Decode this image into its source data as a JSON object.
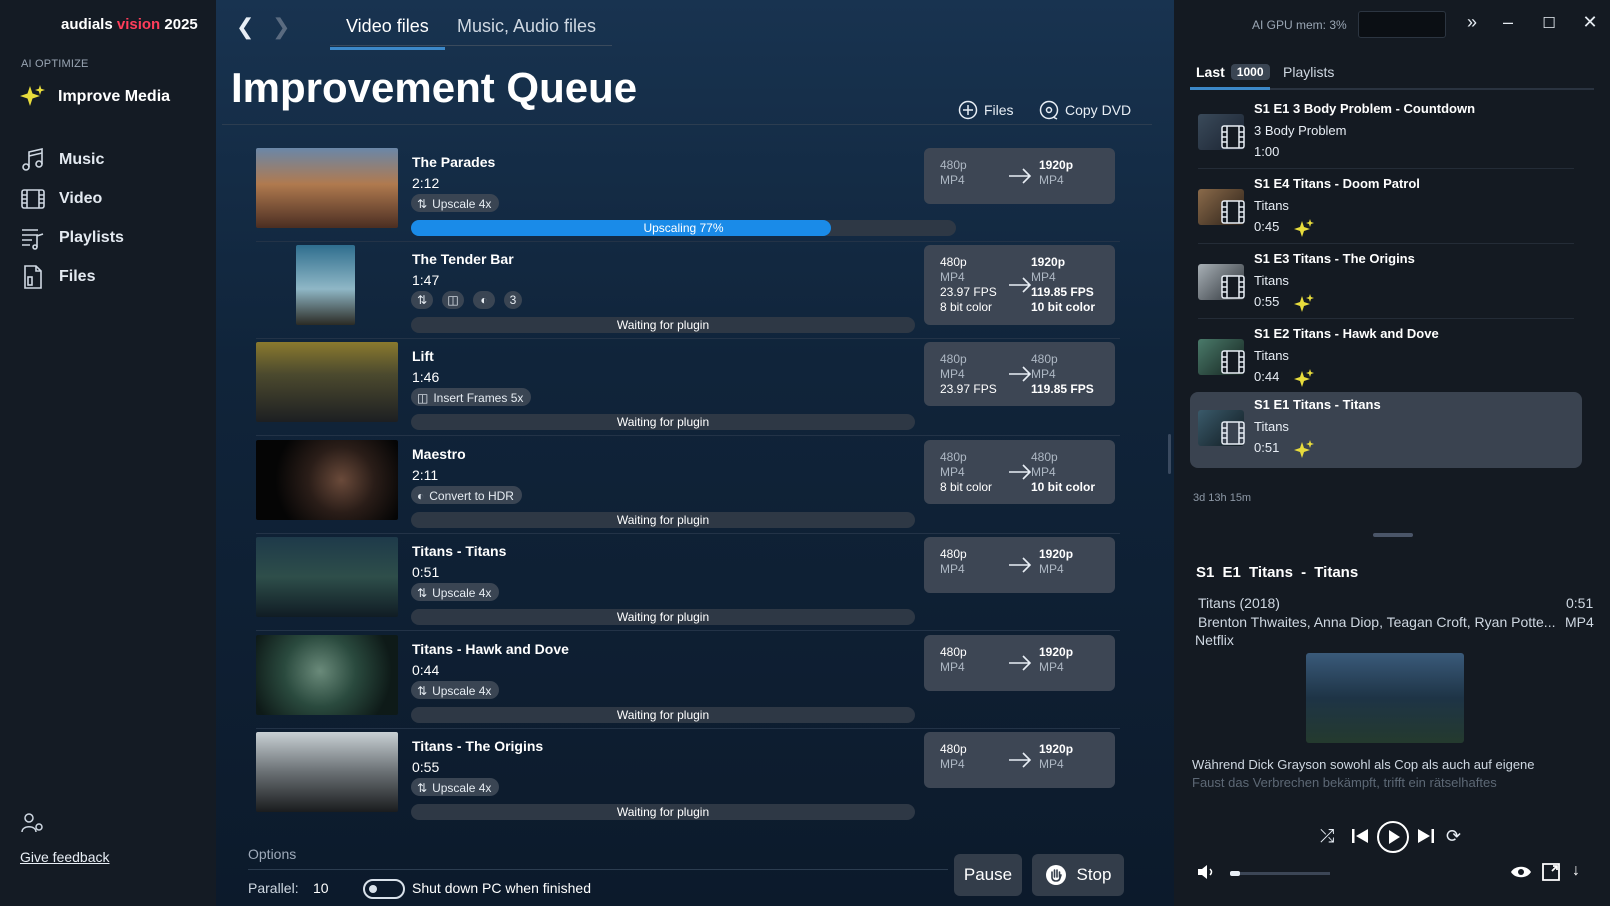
{
  "app": {
    "brand_name": "audials",
    "brand_product": "vision",
    "brand_year": "2025"
  },
  "sidebar": {
    "section": "AI OPTIMIZE",
    "improve": "Improve Media",
    "items": [
      {
        "label": "Music",
        "icon": "music-note-icon"
      },
      {
        "label": "Video",
        "icon": "film-icon"
      },
      {
        "label": "Playlists",
        "icon": "playlist-icon"
      },
      {
        "label": "Files",
        "icon": "file-icon"
      }
    ],
    "feedback": "Give feedback"
  },
  "main": {
    "tabs": [
      "Video files",
      "Music, Audio files"
    ],
    "title": "Improvement Queue",
    "files_btn": "Files",
    "copy_dvd_btn": "Copy DVD",
    "queue": [
      {
        "name": "The Parades",
        "duration": "2:12",
        "chip": "Upscale 4x",
        "status": "Upscaling 77%",
        "progress": 0.77,
        "from": [
          "480p",
          "MP4"
        ],
        "to": [
          "1920p",
          "MP4"
        ]
      },
      {
        "name": "The Tender Bar",
        "duration": "1:47",
        "chip_count": "3",
        "status": "Waiting for plugin",
        "from": [
          "480p",
          "MP4",
          "23.97 FPS",
          "8 bit color"
        ],
        "to": [
          "1920p",
          "MP4",
          "119.85 FPS",
          "10 bit color"
        ]
      },
      {
        "name": "Lift",
        "duration": "1:46",
        "chip": "Insert Frames 5x",
        "status": "Waiting for plugin",
        "from": [
          "480p",
          "MP4",
          "23.97 FPS"
        ],
        "to": [
          "480p",
          "MP4",
          "119.85 FPS"
        ]
      },
      {
        "name": "Maestro",
        "duration": "2:11",
        "chip": "Convert to HDR",
        "status": "Waiting for plugin",
        "from": [
          "480p",
          "MP4",
          "8 bit color"
        ],
        "to": [
          "480p",
          "MP4",
          "10 bit color"
        ]
      },
      {
        "name": "Titans - Titans",
        "duration": "0:51",
        "chip": "Upscale 4x",
        "status": "Waiting for plugin",
        "from": [
          "480p",
          "MP4"
        ],
        "to": [
          "1920p",
          "MP4"
        ]
      },
      {
        "name": "Titans - Hawk and Dove",
        "duration": "0:44",
        "chip": "Upscale 4x",
        "status": "Waiting for plugin",
        "from": [
          "480p",
          "MP4"
        ],
        "to": [
          "1920p",
          "MP4"
        ]
      },
      {
        "name": "Titans - The Origins",
        "duration": "0:55",
        "chip": "Upscale 4x",
        "status": "Waiting for plugin",
        "from": [
          "480p",
          "MP4"
        ],
        "to": [
          "1920p",
          "MP4"
        ]
      }
    ],
    "options_label": "Options",
    "parallel_label": "Parallel:",
    "parallel_value": "10",
    "shutdown_label": "Shut down PC when finished",
    "pause_btn": "Pause",
    "stop_btn": "Stop"
  },
  "right": {
    "gpu": "AI GPU mem: 3%",
    "tab_last": "Last",
    "tab_last_count": "1000",
    "tab_playlists": "Playlists",
    "items": [
      {
        "title": "S1 E1 3 Body Problem - Countdown",
        "sub": "3 Body Problem",
        "dur": "1:00",
        "ai": false
      },
      {
        "title": "S1 E4 Titans - Doom Patrol",
        "sub": "Titans",
        "dur": "0:45",
        "ai": true
      },
      {
        "title": "S1 E3 Titans - The Origins",
        "sub": "Titans",
        "dur": "0:55",
        "ai": true
      },
      {
        "title": "S1 E2 Titans - Hawk and Dove",
        "sub": "Titans",
        "dur": "0:44",
        "ai": true
      },
      {
        "title": "S1 E1 Titans - Titans",
        "sub": "Titans",
        "dur": "0:51",
        "ai": true
      }
    ],
    "total_duration": "3d 13h 15m",
    "detail": {
      "title": "S1  E1  Titans - Titans",
      "series_year": "Titans  (2018)",
      "duration": "0:51",
      "cast": "Brenton Thwaites, Anna Diop, Teagan Croft, Ryan Potte...",
      "format": "MP4",
      "network": "Netflix",
      "desc1": "Während Dick Grayson sowohl als Cop als auch auf eigene",
      "desc2": "Faust das Verbrechen bekämpft, trifft ein rätselhaftes"
    }
  },
  "colors": {
    "accent": "#3c88c8",
    "brand_red": "#ff3d5a",
    "progress": "#1a8be8",
    "spark": "#e8dc3c"
  }
}
